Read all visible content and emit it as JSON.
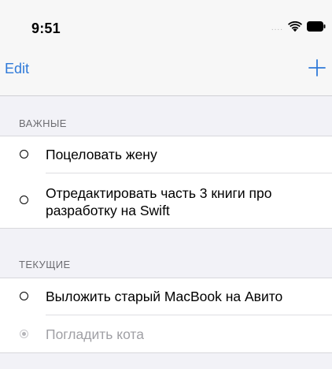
{
  "status_bar": {
    "time": "9:51",
    "signal_dots": "....",
    "wifi_icon": "wifi-icon",
    "battery_icon": "battery-icon"
  },
  "nav": {
    "edit_label": "Edit",
    "add_icon": "plus-icon"
  },
  "colors": {
    "accent": "#2f7ad9",
    "background": "#f2f2f7",
    "cell": "#ffffff",
    "section_text": "#6d6d72",
    "done_text": "#a0a0a5"
  },
  "sections": [
    {
      "header": "ВАЖНЫЕ",
      "items": [
        {
          "text": "Поцеловать жену",
          "done": false
        },
        {
          "text": "Отредактировать часть 3 книги про разработку на Swift",
          "done": false
        }
      ]
    },
    {
      "header": "ТЕКУЩИЕ",
      "items": [
        {
          "text": "Выложить старый MacBook на Авито",
          "done": false
        },
        {
          "text": "Погладить кота",
          "done": true
        }
      ]
    }
  ]
}
